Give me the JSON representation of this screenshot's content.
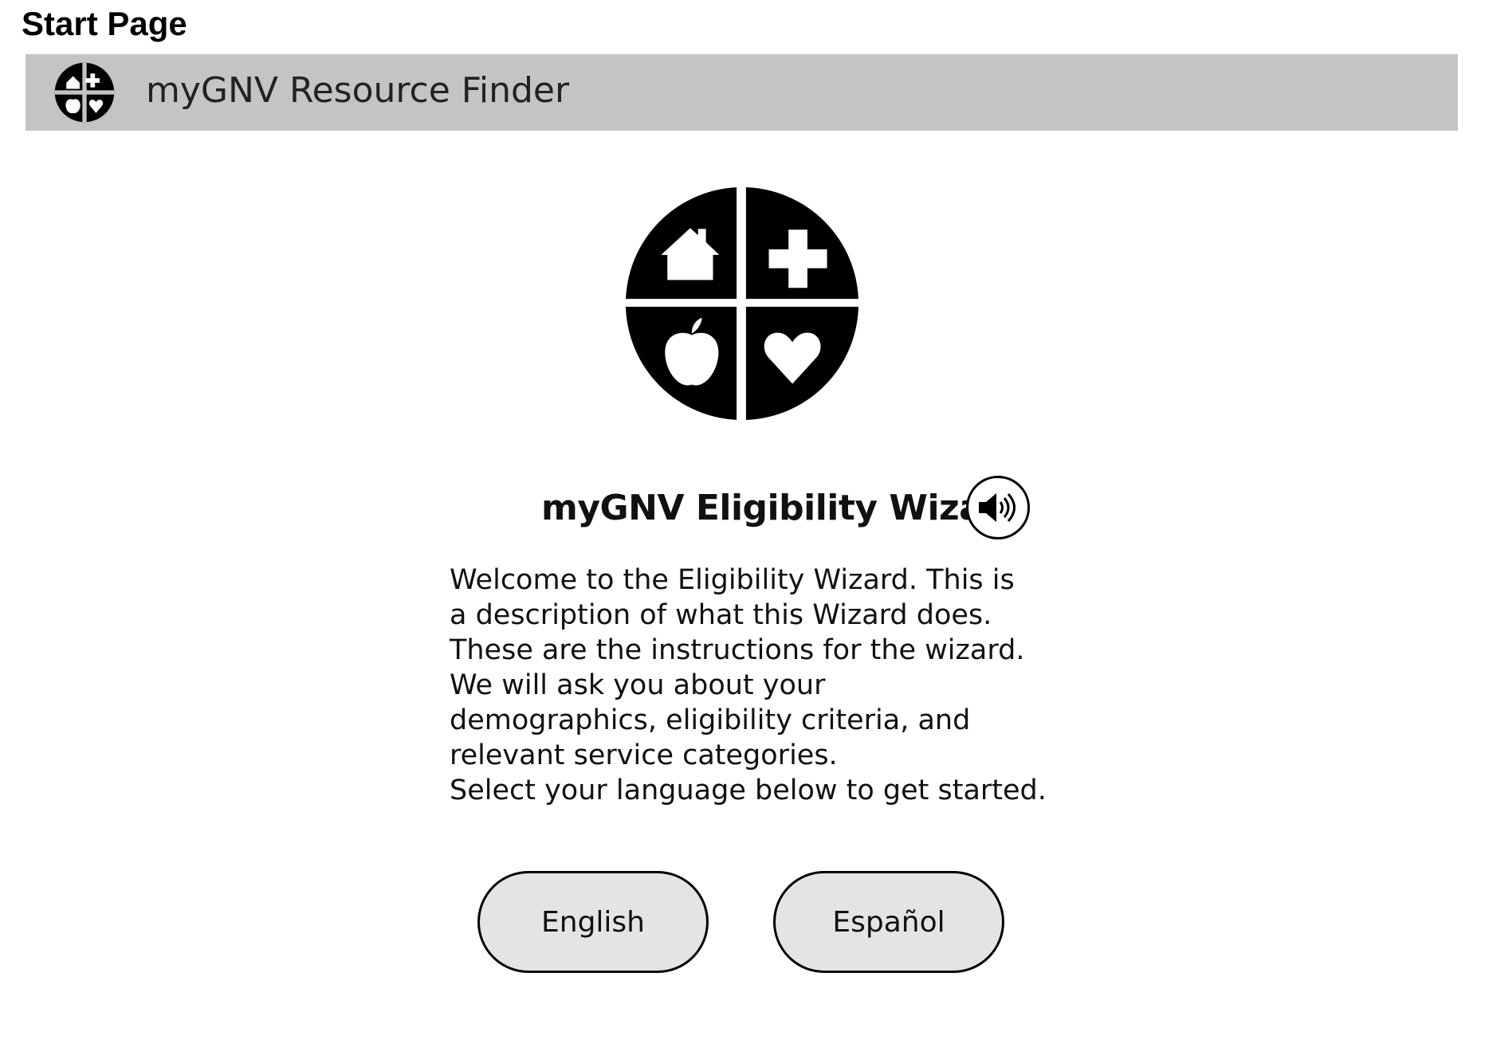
{
  "page_label": "Start Page",
  "app_bar": {
    "title": "myGNV Resource Finder",
    "logo_icon": "mygnv-logo-icon"
  },
  "hero": {
    "logo_icon": "mygnv-logo-icon"
  },
  "wizard": {
    "title": "myGNV Eligibility Wizard",
    "speaker_icon": "speaker-icon",
    "description": "Welcome to the Eligibility Wizard. This is a description of what this Wizard does. These are the instructions for the wizard. We will ask you about your demographics, eligibility criteria, and relevant service categories.",
    "prompt": "Select your language below to get started."
  },
  "languages": {
    "english_label": "English",
    "espanol_label": "Español"
  },
  "colors": {
    "app_bar_bg": "#c4c4c4",
    "button_bg": "#e4e4e4",
    "logo": "#000000"
  }
}
